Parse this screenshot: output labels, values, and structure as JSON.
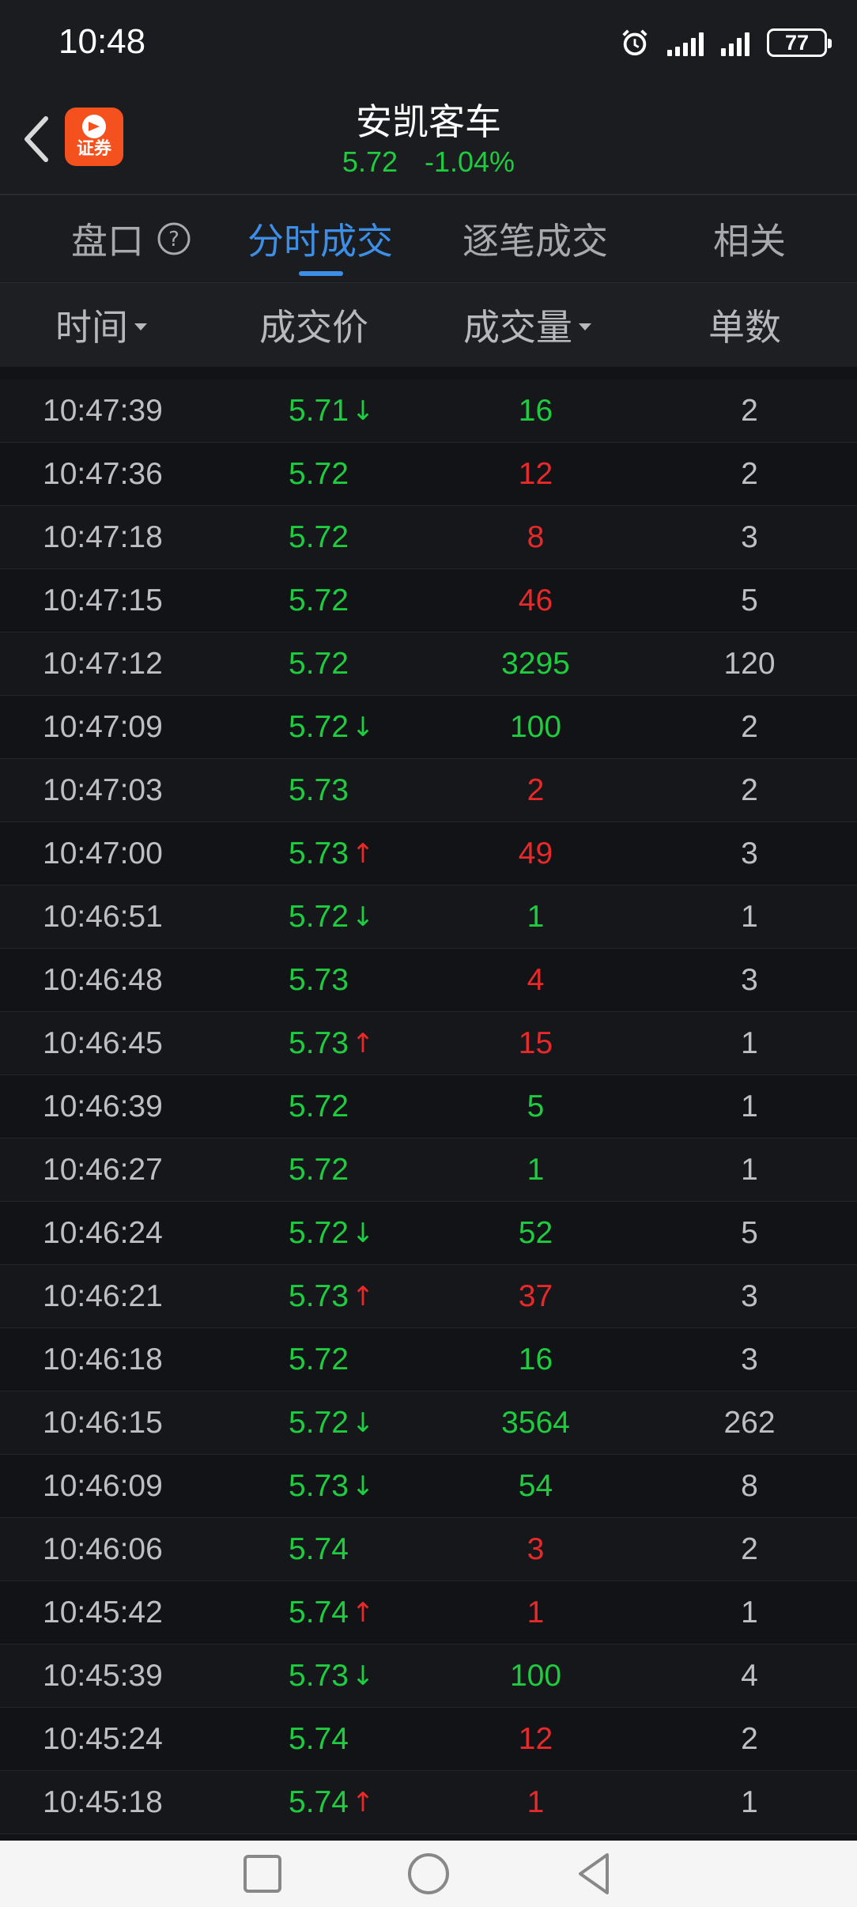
{
  "status_bar": {
    "time": "10:48",
    "battery": "77",
    "icons": [
      "alarm-icon",
      "signal-icon",
      "signal-icon",
      "battery-icon"
    ]
  },
  "header": {
    "stock_name": "安凯客车",
    "price": "5.72",
    "change_pct": "-1.04%",
    "logo_text": "证券"
  },
  "tabs": [
    {
      "label": "盘口"
    },
    {
      "label": "分时成交"
    },
    {
      "label": "逐笔成交"
    },
    {
      "label": "相关"
    }
  ],
  "columns": {
    "time": "时间",
    "price": "成交价",
    "volume": "成交量",
    "count": "单数"
  },
  "rows": [
    {
      "time": "10:47:39",
      "price": "5.71",
      "arrow": "down",
      "volume": "16",
      "vol_color": "green",
      "count": "2"
    },
    {
      "time": "10:47:36",
      "price": "5.72",
      "arrow": "",
      "volume": "12",
      "vol_color": "red",
      "count": "2"
    },
    {
      "time": "10:47:18",
      "price": "5.72",
      "arrow": "",
      "volume": "8",
      "vol_color": "red",
      "count": "3"
    },
    {
      "time": "10:47:15",
      "price": "5.72",
      "arrow": "",
      "volume": "46",
      "vol_color": "red",
      "count": "5"
    },
    {
      "time": "10:47:12",
      "price": "5.72",
      "arrow": "",
      "volume": "3295",
      "vol_color": "green",
      "count": "120"
    },
    {
      "time": "10:47:09",
      "price": "5.72",
      "arrow": "down",
      "volume": "100",
      "vol_color": "green",
      "count": "2"
    },
    {
      "time": "10:47:03",
      "price": "5.73",
      "arrow": "",
      "volume": "2",
      "vol_color": "red",
      "count": "2"
    },
    {
      "time": "10:47:00",
      "price": "5.73",
      "arrow": "up",
      "volume": "49",
      "vol_color": "red",
      "count": "3"
    },
    {
      "time": "10:46:51",
      "price": "5.72",
      "arrow": "down",
      "volume": "1",
      "vol_color": "green",
      "count": "1"
    },
    {
      "time": "10:46:48",
      "price": "5.73",
      "arrow": "",
      "volume": "4",
      "vol_color": "red",
      "count": "3"
    },
    {
      "time": "10:46:45",
      "price": "5.73",
      "arrow": "up",
      "volume": "15",
      "vol_color": "red",
      "count": "1"
    },
    {
      "time": "10:46:39",
      "price": "5.72",
      "arrow": "",
      "volume": "5",
      "vol_color": "green",
      "count": "1"
    },
    {
      "time": "10:46:27",
      "price": "5.72",
      "arrow": "",
      "volume": "1",
      "vol_color": "green",
      "count": "1"
    },
    {
      "time": "10:46:24",
      "price": "5.72",
      "arrow": "down",
      "volume": "52",
      "vol_color": "green",
      "count": "5"
    },
    {
      "time": "10:46:21",
      "price": "5.73",
      "arrow": "up",
      "volume": "37",
      "vol_color": "red",
      "count": "3"
    },
    {
      "time": "10:46:18",
      "price": "5.72",
      "arrow": "",
      "volume": "16",
      "vol_color": "green",
      "count": "3"
    },
    {
      "time": "10:46:15",
      "price": "5.72",
      "arrow": "down",
      "volume": "3564",
      "vol_color": "green",
      "count": "262"
    },
    {
      "time": "10:46:09",
      "price": "5.73",
      "arrow": "down",
      "volume": "54",
      "vol_color": "green",
      "count": "8"
    },
    {
      "time": "10:46:06",
      "price": "5.74",
      "arrow": "",
      "volume": "3",
      "vol_color": "red",
      "count": "2"
    },
    {
      "time": "10:45:42",
      "price": "5.74",
      "arrow": "up",
      "volume": "1",
      "vol_color": "red",
      "count": "1"
    },
    {
      "time": "10:45:39",
      "price": "5.73",
      "arrow": "down",
      "volume": "100",
      "vol_color": "green",
      "count": "4"
    },
    {
      "time": "10:45:24",
      "price": "5.74",
      "arrow": "",
      "volume": "12",
      "vol_color": "red",
      "count": "2"
    },
    {
      "time": "10:45:18",
      "price": "5.74",
      "arrow": "up",
      "volume": "1",
      "vol_color": "red",
      "count": "1"
    }
  ],
  "colors": {
    "up": "#e8292a",
    "down": "#1fcc3f",
    "accent": "#3d8ee6"
  },
  "nav_bar": {
    "icons": [
      "recent-apps-icon",
      "home-icon",
      "back-icon"
    ]
  }
}
